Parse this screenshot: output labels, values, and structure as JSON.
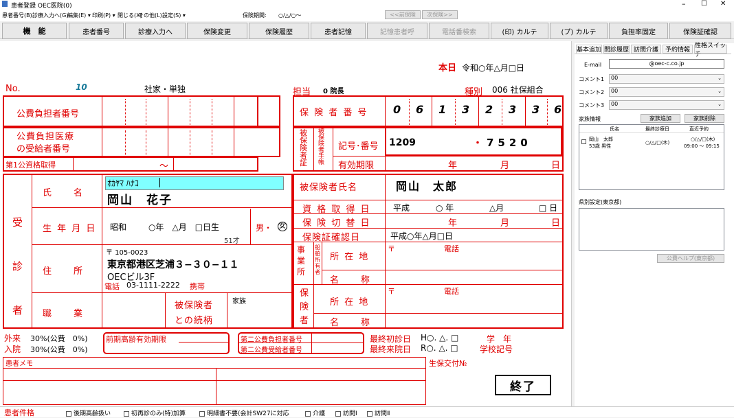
{
  "window": {
    "title": "患者登録 OEC医院(0)",
    "controls": [
      "–",
      "☐",
      "✕"
    ]
  },
  "menu": {
    "items": [
      "患者番号(B)",
      "診療入力へ(G)",
      "編集(E) ▾",
      "印刷(P) ▾",
      "閉じる(X)",
      "その他(L)",
      "設定(S) ▾"
    ],
    "period_label": "保険期間:",
    "period_value": "○/△/○～",
    "prev_btn": "<<前保険",
    "next_btn": "次保険>>"
  },
  "toolbar": {
    "buttons": [
      {
        "label": "機　能",
        "disabled": false,
        "bold": true
      },
      {
        "label": "患者番号",
        "disabled": false
      },
      {
        "label": "診療入力へ",
        "disabled": false
      },
      {
        "label": "保険変更",
        "disabled": false
      },
      {
        "label": "保険履歴",
        "disabled": false
      },
      {
        "label": "患者記憶",
        "disabled": false
      },
      {
        "label": "記憶患者呼",
        "disabled": true
      },
      {
        "label": "電話番検索",
        "disabled": true
      },
      {
        "label": "(印) カルテ",
        "disabled": false
      },
      {
        "label": "(プ) カルテ",
        "disabled": false
      },
      {
        "label": "負担率固定",
        "disabled": false
      },
      {
        "label": "保険証確認",
        "disabled": false
      }
    ]
  },
  "form": {
    "today_label": "本日",
    "today_value": "令和○年△月□日",
    "no_label": "No.",
    "no_value": "10",
    "insurance_type": "社家・単独",
    "tanto_label": "担当",
    "tanto_value": "0 院長",
    "shubetsu_label": "種別",
    "shubetsu_value": "006 社保組合",
    "public_payer_label": "公費負担者番号",
    "public_recipient_label_1": "公費負担医療",
    "public_recipient_label_2": "の受給者番号",
    "first_public_label": "第1公資格取得",
    "tilde": "～",
    "insurer_no_label": "保 険 者 番 号",
    "insurer_digits": [
      "0",
      "6",
      "1",
      "3",
      "2",
      "3",
      "3",
      "6"
    ],
    "hihoken_label": "被保険者証",
    "techo_label": "被保険者手帳",
    "kigo_label": "記号･番号",
    "kigo_value": "1209",
    "kigo_dot": "・",
    "kigo_number": "7520",
    "yuko_label": "有効期限",
    "yuko_value": [
      "年",
      "月",
      "日"
    ],
    "jushin_label": "受　診　者",
    "name_label": "氏　　名",
    "kana_value": "ｵｶﾔﾏ ﾊﾅｺ",
    "name_value": "岡山　花子",
    "hiho_name_label": "被保険者氏名",
    "hiho_name_value": "岡山　太郎",
    "birth_label": "生 年 月 日",
    "birth_era": "昭和",
    "birth_value": "○年　△月　□日生",
    "sex_value": "男・",
    "sex_selected": "女",
    "age_value": "51才",
    "shikaku_label": "資 格 取 得 日",
    "shikaku_value": [
      "平成",
      "○ 年",
      "△月",
      "□ 日"
    ],
    "kirikae_label": "保 険 切 替 日",
    "kirikae_value": [
      "年",
      "月",
      "日"
    ],
    "kakunin_label": "保険証確認日",
    "kakunin_value": "平成○年△月□日",
    "address_label": "住　　所",
    "postal_value": "〒 105-0023",
    "address_1": "東京都港区芝浦３−３０−１１",
    "address_2": "OECビル3F",
    "tel_label": "電話",
    "tel_value": "03-1111-2222",
    "mobile_label": "携帯",
    "jigyosho_label": "事業所",
    "senpaku_label": "船舶所有者",
    "shozaichi_label": "所 在 地",
    "meisho_label": "名　　称",
    "postal_mark": "〒",
    "denwa_label": "電話",
    "hoken_label": "保険者",
    "job_label": "職　　業",
    "relation_label_1": "被保険者",
    "relation_label_2": "との続柄",
    "relation_value": "家族",
    "gairai_label": "外来",
    "gairai_value": "30%(公費　0%)",
    "nyuin_label": "入院",
    "nyuin_value": "30%(公費　0%)",
    "koki_label": "前期高齢有効期限",
    "second_payer_label": "第二公費負担者番号",
    "second_recipient_label": "第二公費受給者番号",
    "last_visit_label": "最終初診日",
    "last_visit_value": "H○. △. □",
    "last_in_label": "最終来院日",
    "last_in_value": "R○. △. □",
    "gakunen_label": "学　年",
    "gakko_label": "学校記号",
    "memo_label": "患者メモ",
    "seiho_label": "生保交付№",
    "end_button": "終了"
  },
  "side": {
    "tabs": [
      "基本追加",
      "問診履歴",
      "訪問介護",
      "予約情報",
      "性格スイッチ"
    ],
    "email_label": "E-mail",
    "email_value": "@oec-c.co.jp",
    "comments": [
      {
        "label": "コメント1",
        "value": "00"
      },
      {
        "label": "コメント2",
        "value": "00"
      },
      {
        "label": "コメント3",
        "value": "00"
      }
    ],
    "family_label": "家族情報",
    "family_add": "家族追加",
    "family_delete": "家族削除",
    "family_columns": [
      "氏名",
      "最終診療日",
      "直近予約"
    ],
    "family_rows": [
      {
        "name": "岡山　太郎",
        "sub": "53歳 男性",
        "last": "○/△/□(木)",
        "next": "○/△/□(木)",
        "next_time": "09:00 ～ 09:15"
      }
    ],
    "prefecture_label": "県別設定(東京都)",
    "help_button": "公費ヘルプ(東京都)"
  },
  "status": {
    "label": "患者件格",
    "checks": [
      "後期高齢扱い",
      "初再診のみ(特)加算",
      "明細書不要(会計SW27に対応",
      "介護",
      "訪問Ⅰ",
      "訪問Ⅱ"
    ]
  },
  "colors": {
    "accent": "#e00000",
    "kana_bg": "#80ffff"
  }
}
